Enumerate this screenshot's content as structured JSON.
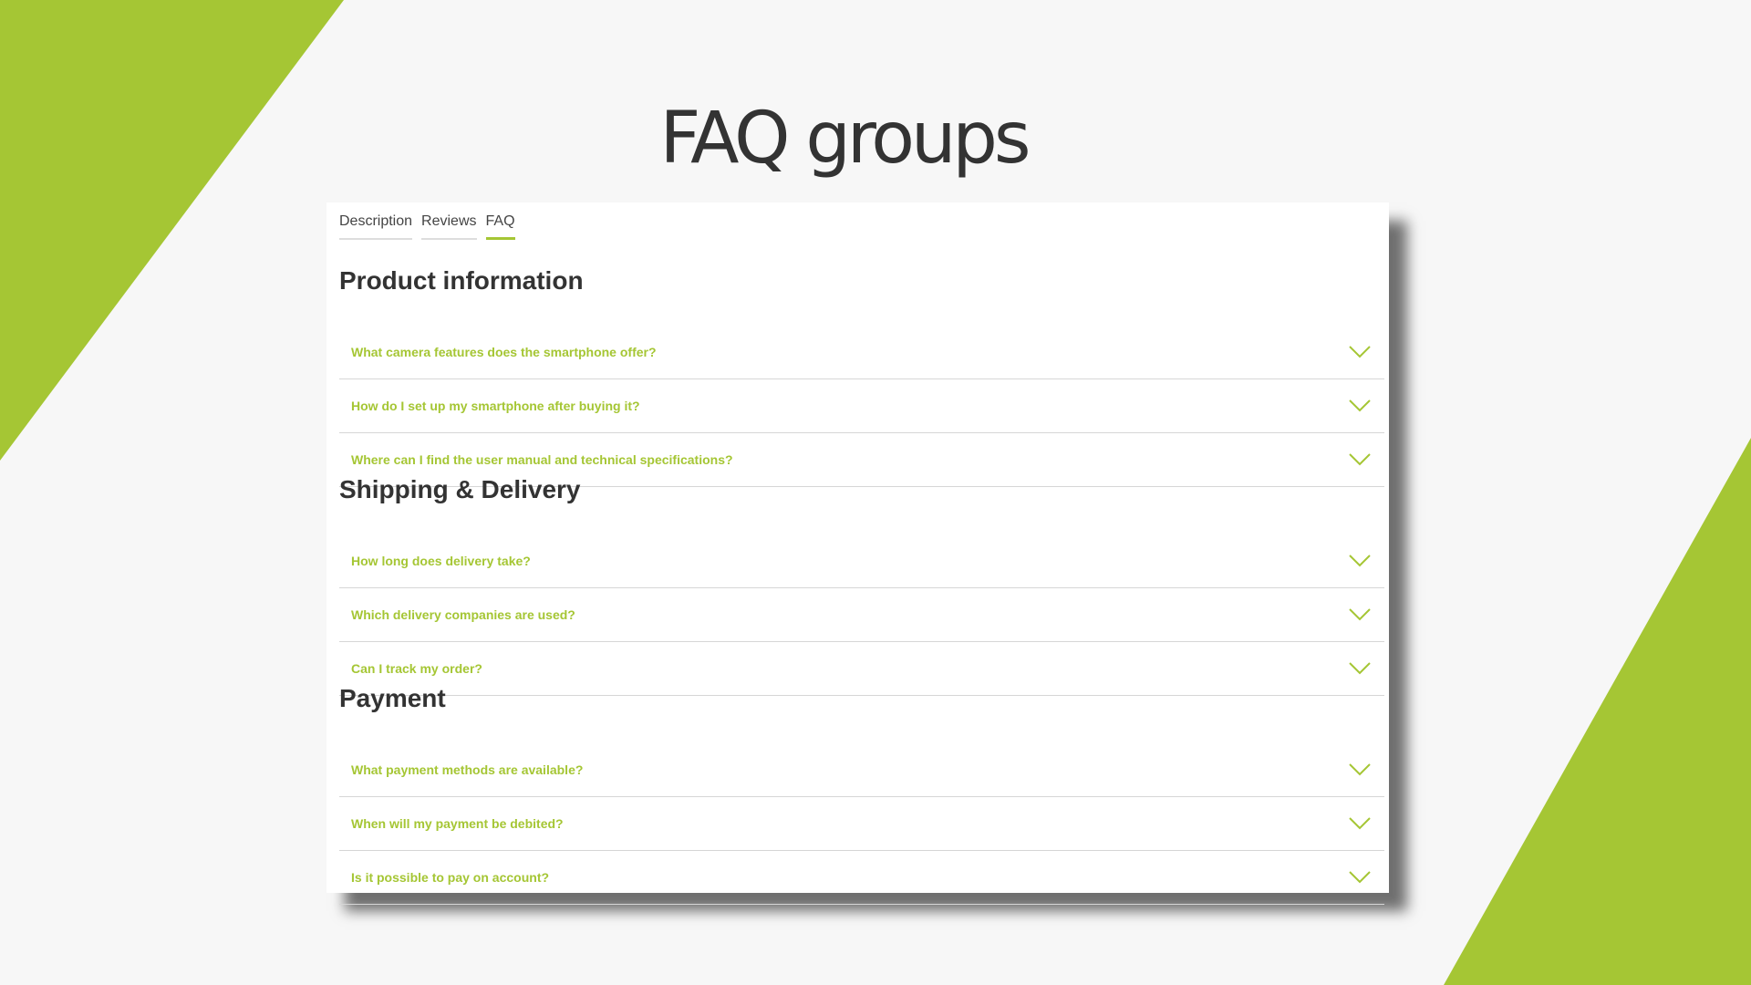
{
  "colors": {
    "accent": "#a5c634",
    "background": "#f7f7f7",
    "panel": "#ffffff",
    "heading": "#333333",
    "divider": "#d6d6d6"
  },
  "slide": {
    "title": "FAQ groups"
  },
  "tabs": [
    {
      "label": "Description",
      "active": false
    },
    {
      "label": "Reviews",
      "active": false
    },
    {
      "label": "FAQ",
      "active": true
    }
  ],
  "groups": [
    {
      "title": "Product information",
      "questions": [
        "What camera features does the smartphone offer?",
        "How do I set up my smartphone after buying it?",
        "Where can I find the user manual and technical specifications?"
      ]
    },
    {
      "title": "Shipping & Delivery",
      "questions": [
        "How long does delivery take?",
        "Which delivery companies are used?",
        "Can I track my order?"
      ]
    },
    {
      "title": "Payment",
      "questions": [
        "What payment methods are available?",
        "When will my payment be debited?",
        "Is it possible to pay on account?"
      ]
    }
  ],
  "icons": {
    "expand": "chevron-down-icon"
  }
}
